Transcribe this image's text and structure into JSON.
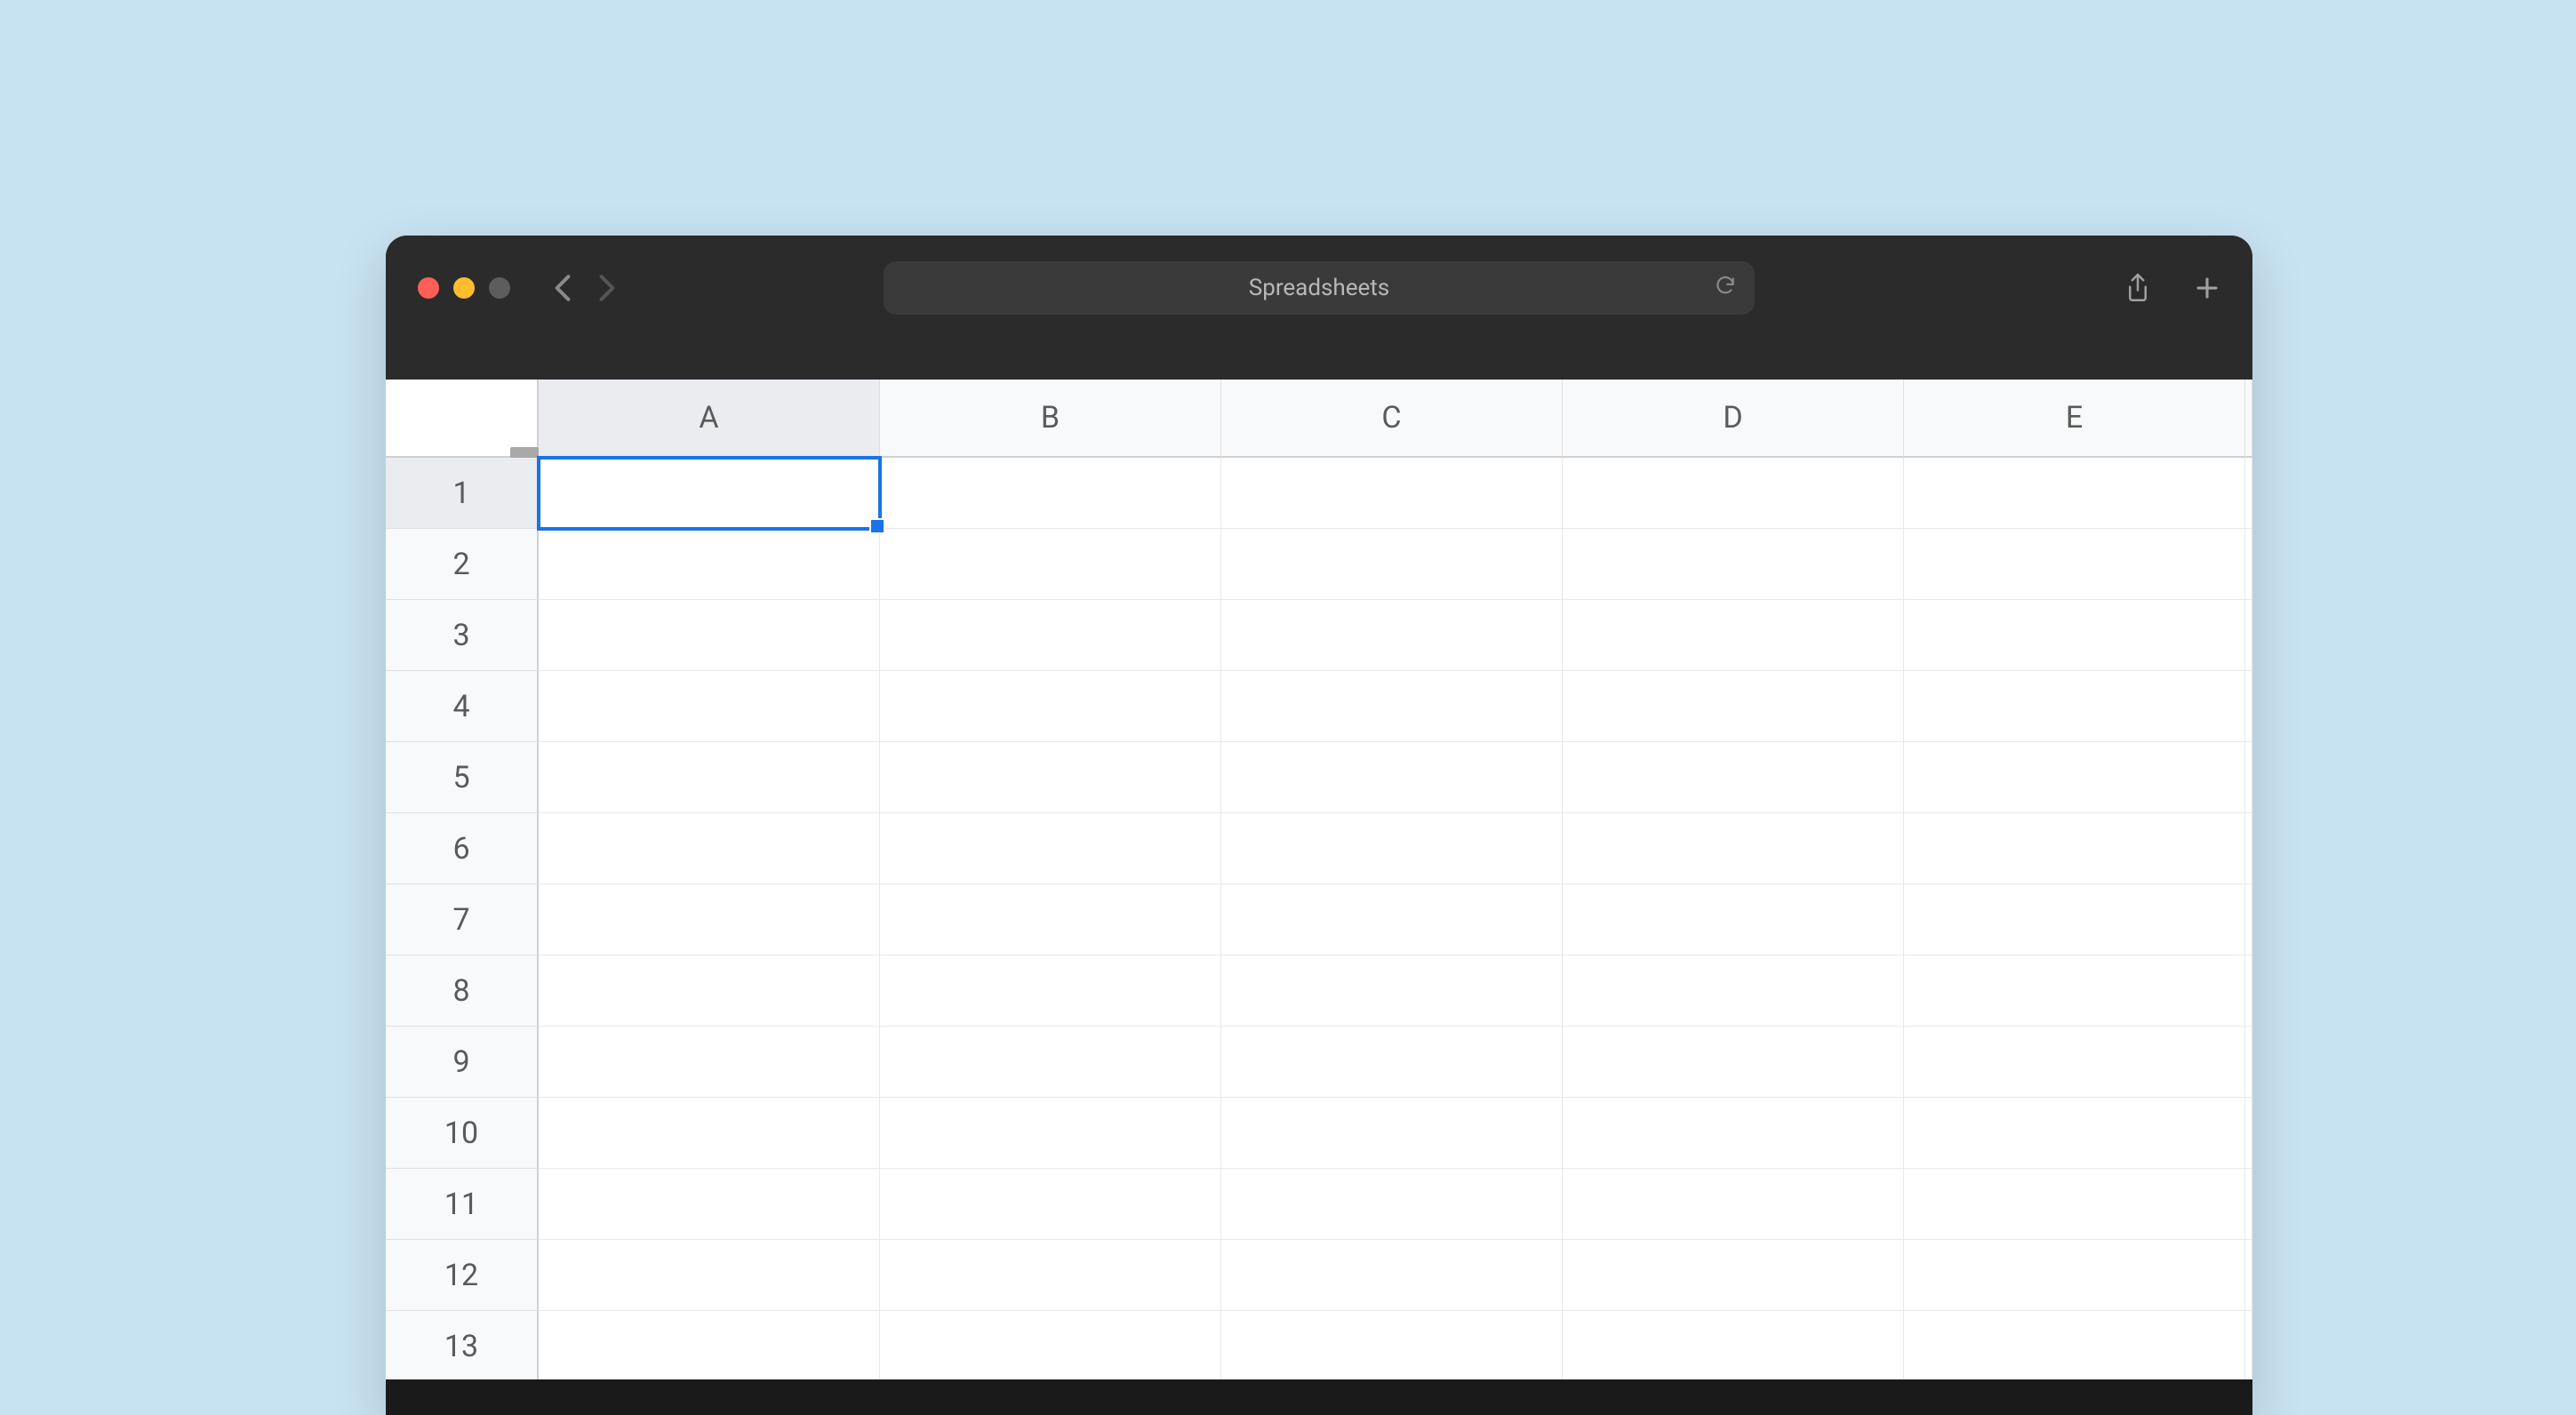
{
  "browser": {
    "address_text": "Spreadsheets"
  },
  "spreadsheet": {
    "columns": [
      "A",
      "B",
      "C",
      "D",
      "E"
    ],
    "rows": [
      "1",
      "2",
      "3",
      "4",
      "5",
      "6",
      "7",
      "8",
      "9",
      "10",
      "11",
      "12",
      "13"
    ],
    "selected_cell": "A1",
    "selected_column": "A",
    "selected_row": "1",
    "cells": {}
  }
}
